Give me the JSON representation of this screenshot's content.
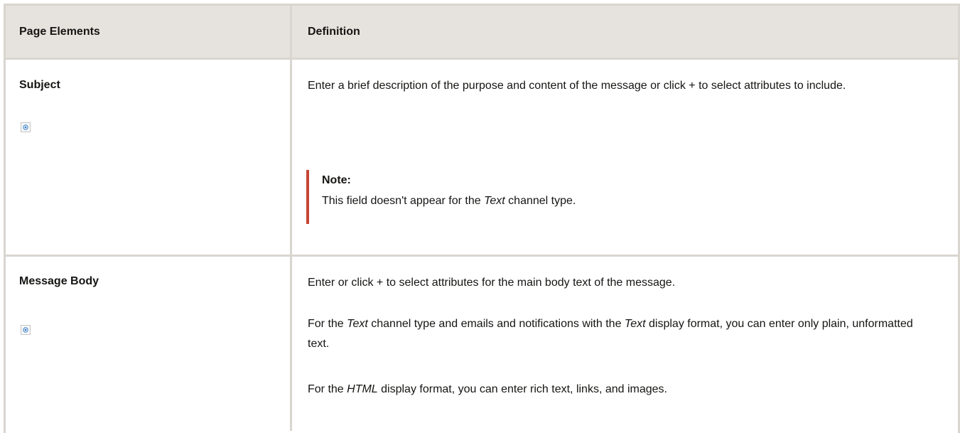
{
  "table": {
    "headers": {
      "col1": "Page Elements",
      "col2": "Definition"
    },
    "rows": [
      {
        "term": "Subject",
        "icon": "add-attribute-icon",
        "definition": {
          "p1": "Enter a brief description of the purpose and content of the message or click + to select attributes to include.",
          "note": {
            "title": "Note:",
            "text_before": "This field doesn't appear for the ",
            "text_em": "Text",
            "text_after": " channel type."
          }
        }
      },
      {
        "term": "Message Body",
        "icon": "add-attribute-icon",
        "definition": {
          "p1": "Enter or click + to select attributes for the main body text of the message.",
          "p2": {
            "part1": "For the ",
            "em1": "Text",
            "part2": " channel type and emails and notifications with the ",
            "em2": "Text",
            "part3": " display format, you can enter only plain, unformatted text."
          },
          "p3": {
            "part1": "For the ",
            "em1": "HTML",
            "part2": " display format, you can enter rich text, links, and images."
          }
        }
      }
    ]
  },
  "colors": {
    "header_bg": "#e6e3de",
    "border": "#d9d6d0",
    "note_accent": "#c74634"
  }
}
